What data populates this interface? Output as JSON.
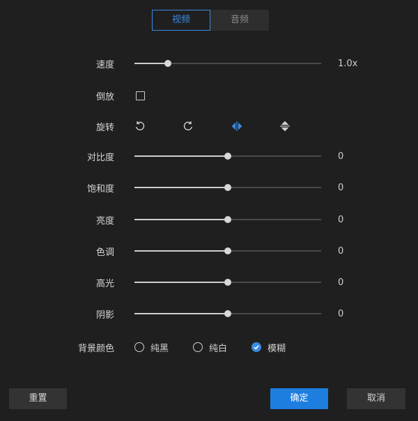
{
  "tabs": [
    "视频",
    "音频"
  ],
  "speed": {
    "label": "速度",
    "value_text": "1.0x",
    "level": 0.18
  },
  "reverse": {
    "label": "倒放",
    "checked": false
  },
  "rotate": {
    "label": "旋转",
    "icons": [
      "rotate-left-icon",
      "rotate-right-icon",
      "flip-horizontal-icon",
      "flip-vertical-icon"
    ],
    "active_color": "#3a8be0"
  },
  "adjustments": [
    {
      "label": "对比度",
      "value": "0",
      "level": 0.5
    },
    {
      "label": "饱和度",
      "value": "0",
      "level": 0.5
    },
    {
      "label": "亮度",
      "value": "0",
      "level": 0.5
    },
    {
      "label": "色调",
      "value": "0",
      "level": 0.5
    },
    {
      "label": "高光",
      "value": "0",
      "level": 0.5
    },
    {
      "label": "阴影",
      "value": "0",
      "level": 0.5
    }
  ],
  "background": {
    "label": "背景颜色",
    "options": [
      "纯黑",
      "纯白",
      "模糊"
    ],
    "selected": "模糊"
  },
  "buttons": {
    "reset": "重置",
    "confirm": "确定",
    "cancel": "取消"
  },
  "colors": {
    "accent": "#3a8be0",
    "primary_button": "#1e7ee0",
    "background": "#1f1f1f"
  }
}
